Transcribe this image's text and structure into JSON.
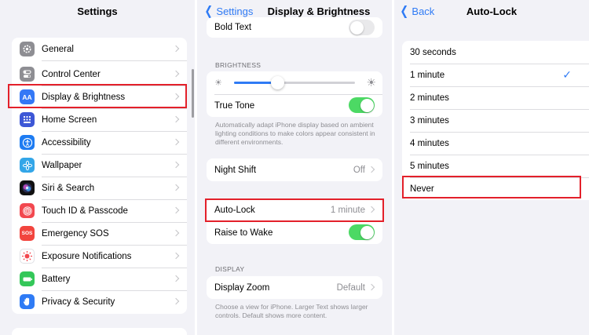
{
  "colors": {
    "accent": "#2f7bf5",
    "highlight": "#e3202a",
    "toggle_on": "#4cd964",
    "toggle_off": "#e9e9eb"
  },
  "settings": {
    "title": "Settings",
    "items": [
      {
        "label": "General",
        "icon": "gear-icon",
        "color": "#8e8e93"
      },
      {
        "label": "Control Center",
        "icon": "toggles-icon",
        "color": "#8e8e93"
      },
      {
        "label": "Display & Brightness",
        "icon": "text-size-icon",
        "color": "#3478f6",
        "icon_text": "AA",
        "highlighted": true
      },
      {
        "label": "Home Screen",
        "icon": "grid-icon",
        "color": "#3d57d6"
      },
      {
        "label": "Accessibility",
        "icon": "accessibility-icon",
        "color": "#1e7cf2"
      },
      {
        "label": "Wallpaper",
        "icon": "flower-icon",
        "color": "#33a6e8"
      },
      {
        "label": "Siri & Search",
        "icon": "siri-icon",
        "color": "#222"
      },
      {
        "label": "Touch ID & Passcode",
        "icon": "fingerprint-icon",
        "color": "#f2484f"
      },
      {
        "label": "Emergency SOS",
        "icon": "sos-icon",
        "color": "#f2453e",
        "icon_text": "SOS"
      },
      {
        "label": "Exposure Notifications",
        "icon": "exposure-icon",
        "color": "#fff"
      },
      {
        "label": "Battery",
        "icon": "battery-icon",
        "color": "#34c759"
      },
      {
        "label": "Privacy & Security",
        "icon": "hand-icon",
        "color": "#2f7bf5"
      }
    ]
  },
  "display": {
    "back_label": "Settings",
    "title": "Display & Brightness",
    "bold_text_label": "Bold Text",
    "brightness_header": "BRIGHTNESS",
    "brightness_level": 0.36,
    "true_tone_label": "True Tone",
    "true_tone_footer": "Automatically adapt iPhone display based on ambient lighting conditions to make colors appear consistent in different environments.",
    "night_shift_label": "Night Shift",
    "night_shift_value": "Off",
    "auto_lock_label": "Auto-Lock",
    "auto_lock_value": "1 minute",
    "raise_to_wake_label": "Raise to Wake",
    "display_header": "DISPLAY",
    "display_zoom_label": "Display Zoom",
    "display_zoom_value": "Default",
    "display_zoom_footer": "Choose a view for iPhone. Larger Text shows larger controls. Default shows more content."
  },
  "autolock": {
    "back_label": "Back",
    "title": "Auto-Lock",
    "options": [
      {
        "label": "30 seconds",
        "selected": false
      },
      {
        "label": "1 minute",
        "selected": true
      },
      {
        "label": "2 minutes",
        "selected": false
      },
      {
        "label": "3 minutes",
        "selected": false
      },
      {
        "label": "4 minutes",
        "selected": false
      },
      {
        "label": "5 minutes",
        "selected": false
      },
      {
        "label": "Never",
        "selected": false,
        "highlighted": true
      }
    ]
  }
}
